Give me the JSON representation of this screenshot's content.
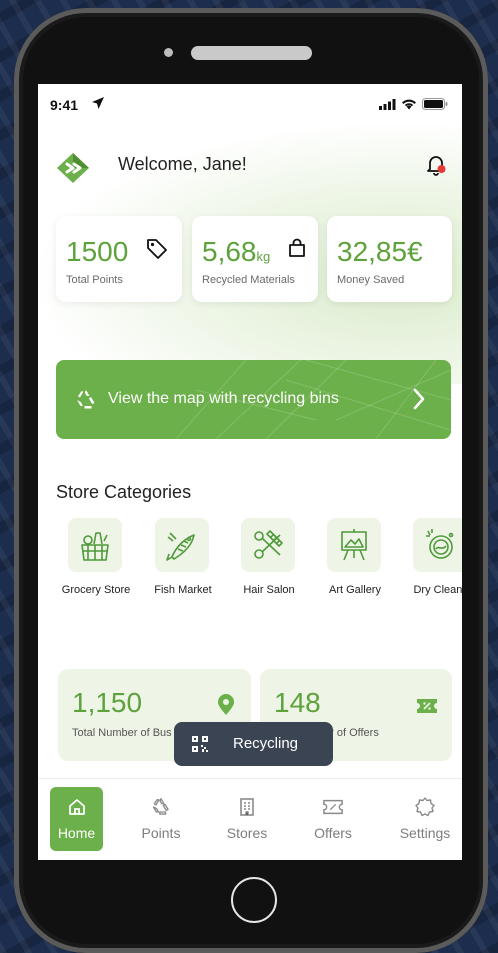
{
  "status_bar": {
    "time": "9:41"
  },
  "header": {
    "welcome": "Welcome, Jane!"
  },
  "stats": [
    {
      "value": "1500",
      "unit": "",
      "label": "Total Points"
    },
    {
      "value": "5,68",
      "unit": "kg",
      "label": "Recycled Materials"
    },
    {
      "value": "32,85€",
      "unit": "",
      "label": "Money Saved"
    }
  ],
  "map_banner": {
    "text": "View the map with recycling bins"
  },
  "categories": {
    "title": "Store Categories",
    "items": [
      {
        "label": "Grocery Store",
        "icon": "grocery-icon"
      },
      {
        "label": "Fish Market",
        "icon": "fish-icon"
      },
      {
        "label": "Hair Salon",
        "icon": "scissors-comb-icon"
      },
      {
        "label": "Art Gallery",
        "icon": "easel-icon"
      },
      {
        "label": "Dry Cleane",
        "icon": "washing-machine-icon"
      }
    ]
  },
  "business": [
    {
      "value": "1,150",
      "label": "Total Number of Bus"
    },
    {
      "value": "148",
      "label": "er of Offers"
    }
  ],
  "toast": {
    "label": "Recycling"
  },
  "tabs": [
    {
      "label": "Home",
      "icon": "home-icon",
      "active": true
    },
    {
      "label": "Points",
      "icon": "recycle-icon",
      "active": false
    },
    {
      "label": "Stores",
      "icon": "building-icon",
      "active": false
    },
    {
      "label": "Offers",
      "icon": "ticket-icon",
      "active": false
    },
    {
      "label": "Settings",
      "icon": "gear-icon",
      "active": false
    }
  ],
  "colors": {
    "accent": "#6bb04a",
    "accent_text": "#5ea23c",
    "light_green": "#eef5e7",
    "notification": "#e53935",
    "toast_bg": "#3a4453"
  }
}
